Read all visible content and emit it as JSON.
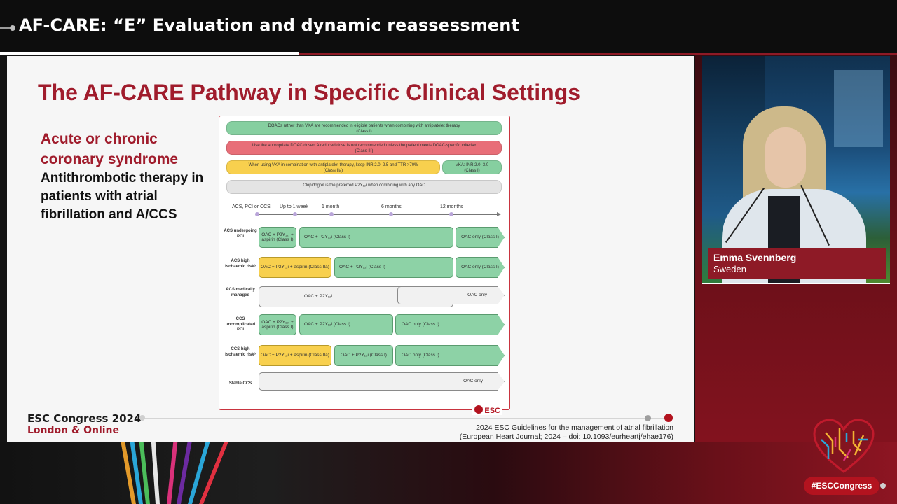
{
  "header": {
    "title": "AF-CARE: “E” Evaluation and dynamic reassessment"
  },
  "slide": {
    "title": "The AF-CARE Pathway in Specific Clinical Settings",
    "side_heading": "Acute or chronic coronary syndrome",
    "side_subheading": "Antithrombotic therapy in patients with atrial fibrillation and A/CCS",
    "footer_event": "ESC Congress 2024",
    "footer_location": "London & Online",
    "citation_line1": "2024 ESC Guidelines for the management of atrial fibrillation",
    "citation_line2": "(European Heart Journal; 2024 – doi: 10.1093/eurheartj/ehae176)"
  },
  "figure": {
    "recommendations": [
      "DOACs rather than VKA are recommended in eligible patients when combining with antiplatelet therapy",
      "(Class I)",
      "Use the appropriate DOAC doseᵃ. A reduced dose is not recommended unless the patient meets DOAC-specific criteriaᵃ",
      "(Class III)",
      "When using VKA in combination with antiplatelet therapy, keep INR 2.0–2.5 and TTR >70%",
      "(Class IIa)",
      "VKA: INR 2.0–3.0",
      "(Class I)",
      "Clopidogrel is the preferred P2Y₁₂i when combining with any OAC"
    ],
    "timeline": [
      "ACS, PCI or CCS",
      "Up to 1 week",
      "1 month",
      "6 months",
      "12 months"
    ],
    "rows": [
      {
        "label": "ACS undergoing PCI",
        "bars": [
          "OAC + P2Y₁₂i + aspirin (Class I)",
          "OAC + P2Y₁₂i (Class I)",
          "OAC only (Class I)"
        ]
      },
      {
        "label": "ACS high ischaemic riskᵇ",
        "bars": [
          "OAC + P2Y₁₂i + aspirin (Class IIa)",
          "OAC + P2Y₁₂i (Class I)",
          "OAC only (Class I)"
        ]
      },
      {
        "label": "ACS medically managed",
        "bars": [
          "OAC + P2Y₁₂i",
          "OAC only"
        ]
      },
      {
        "label": "CCS uncomplicated PCI",
        "bars": [
          "OAC + P2Y₁₂i + aspirin (Class I)",
          "OAC + P2Y₁₂i (Class I)",
          "OAC only (Class I)"
        ]
      },
      {
        "label": "CCS high ischaemic riskᵇ",
        "bars": [
          "OAC + P2Y₁₂i + aspirin (Class IIa)",
          "OAC + P2Y₁₂i (Class I)",
          "OAC only (Class I)"
        ]
      },
      {
        "label": "Stable CCS",
        "bars": [
          "OAC only"
        ]
      }
    ],
    "logo": "ESC"
  },
  "speaker": {
    "name": "Emma Svennberg",
    "country": "Sweden"
  },
  "hashtag": "#ESCCongress",
  "colors": {
    "brand_red": "#a01c2c",
    "accent_red": "#b3131f",
    "green": "#8dd2a6",
    "yellow": "#f8d04e"
  }
}
